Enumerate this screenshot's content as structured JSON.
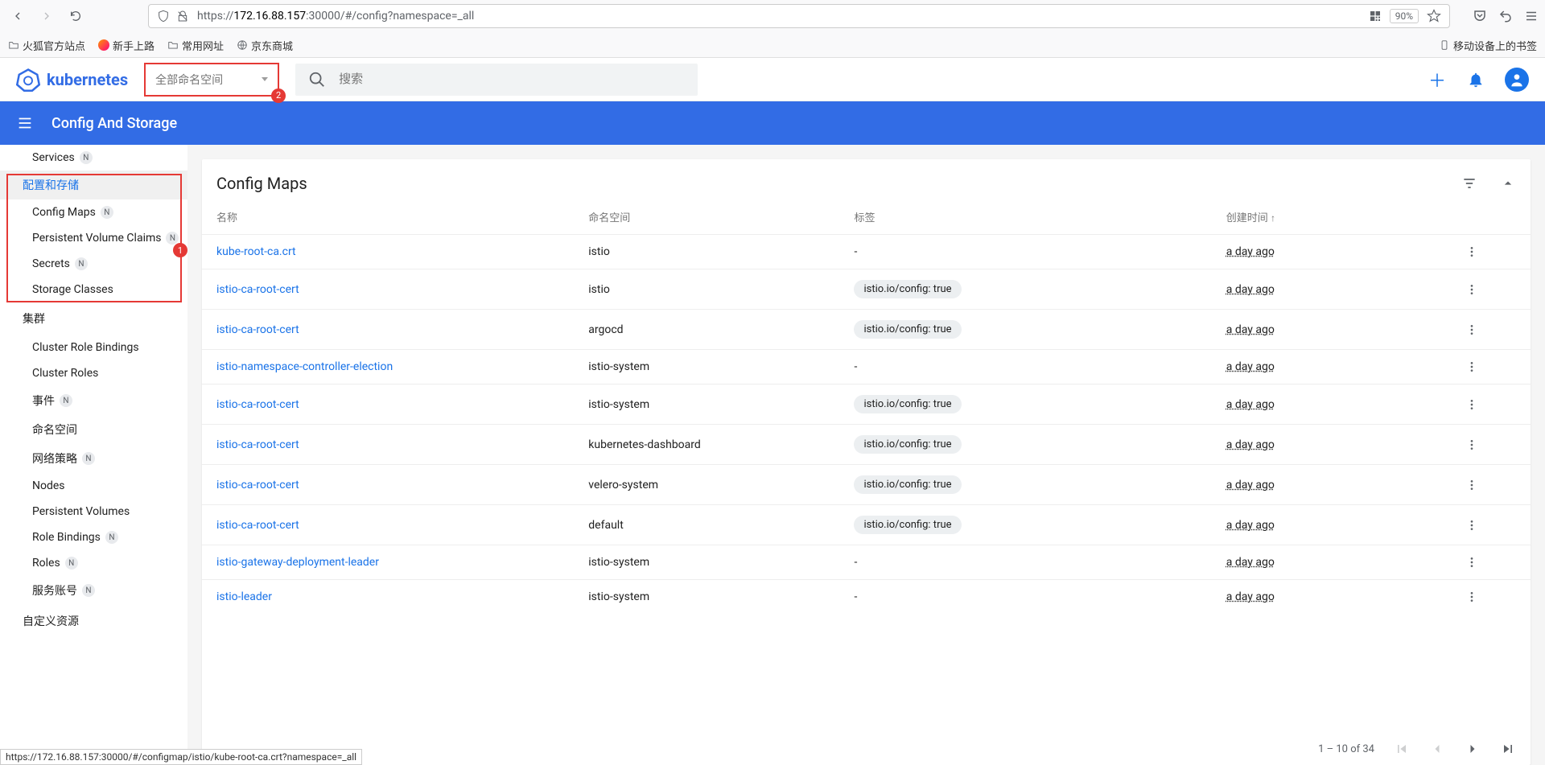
{
  "browser": {
    "url_prefix": "https://",
    "url_host": "172.16.88.157",
    "url_path": ":30000/#/config?namespace=_all",
    "zoom": "90%",
    "bookmarks": [
      "火狐官方站点",
      "新手上路",
      "常用网址",
      "京东商城"
    ],
    "mobile_bookmark": "移动设备上的书签"
  },
  "header": {
    "brand": "kubernetes",
    "namespace_selector": "全部命名空间",
    "ns_badge": "2",
    "search_placeholder": "搜索"
  },
  "bluebar": {
    "title": "Config And Storage"
  },
  "sidebar": {
    "services": "Services",
    "config_storage": "配置和存储",
    "config_maps": "Config Maps",
    "pvc": "Persistent Volume Claims",
    "secrets": "Secrets",
    "storage_classes": "Storage Classes",
    "cluster": "集群",
    "crb": "Cluster Role Bindings",
    "cr": "Cluster Roles",
    "events": "事件",
    "namespaces": "命名空间",
    "netpol": "网络策略",
    "nodes": "Nodes",
    "pv": "Persistent Volumes",
    "rb": "Role Bindings",
    "roles": "Roles",
    "sa": "服务账号",
    "crd": "自定义资源",
    "hl_badge": "1",
    "n": "N"
  },
  "table": {
    "title": "Config Maps",
    "cols": {
      "name": "名称",
      "namespace": "命名空间",
      "labels": "标签",
      "created": "创建时间"
    },
    "rows": [
      {
        "name": "kube-root-ca.crt",
        "ns": "istio",
        "labels": "-",
        "time": "a day ago"
      },
      {
        "name": "istio-ca-root-cert",
        "ns": "istio",
        "labels": "istio.io/config: true",
        "time": "a day ago"
      },
      {
        "name": "istio-ca-root-cert",
        "ns": "argocd",
        "labels": "istio.io/config: true",
        "time": "a day ago"
      },
      {
        "name": "istio-namespace-controller-election",
        "ns": "istio-system",
        "labels": "-",
        "time": "a day ago"
      },
      {
        "name": "istio-ca-root-cert",
        "ns": "istio-system",
        "labels": "istio.io/config: true",
        "time": "a day ago"
      },
      {
        "name": "istio-ca-root-cert",
        "ns": "kubernetes-dashboard",
        "labels": "istio.io/config: true",
        "time": "a day ago"
      },
      {
        "name": "istio-ca-root-cert",
        "ns": "velero-system",
        "labels": "istio.io/config: true",
        "time": "a day ago"
      },
      {
        "name": "istio-ca-root-cert",
        "ns": "default",
        "labels": "istio.io/config: true",
        "time": "a day ago"
      },
      {
        "name": "istio-gateway-deployment-leader",
        "ns": "istio-system",
        "labels": "-",
        "time": "a day ago"
      },
      {
        "name": "istio-leader",
        "ns": "istio-system",
        "labels": "-",
        "time": "a day ago"
      }
    ],
    "pager": "1 – 10 of 34"
  },
  "status": "https://172.16.88.157:30000/#/configmap/istio/kube-root-ca.crt?namespace=_all"
}
